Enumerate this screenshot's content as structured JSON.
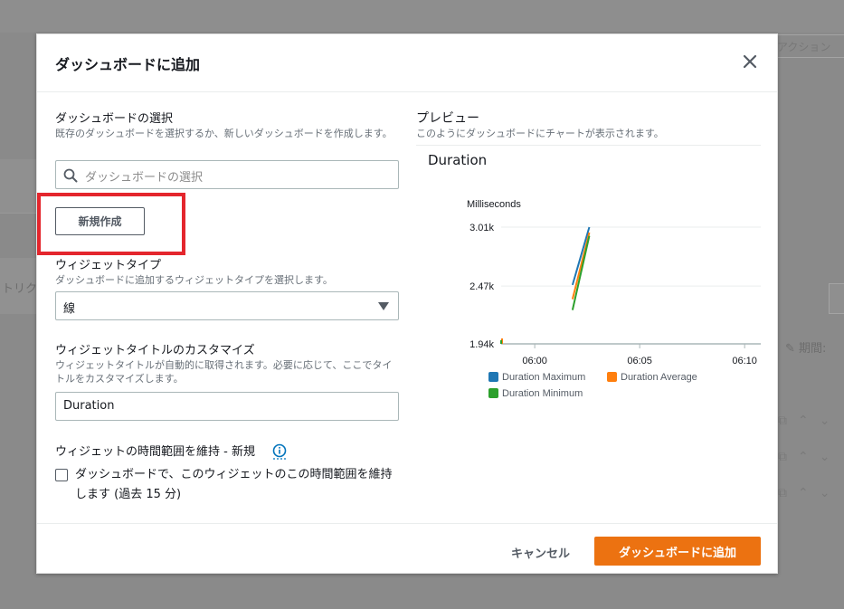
{
  "background": {
    "action_label": "アクション",
    "side_label": "トリク",
    "period_label": "期間:"
  },
  "modal": {
    "title": "ダッシュボードに追加",
    "dashboard_select": {
      "label": "ダッシュボードの選択",
      "description": "既存のダッシュボードを選択するか、新しいダッシュボードを作成します。",
      "placeholder": "ダッシュボードの選択"
    },
    "new_button": "新規作成",
    "widget_type": {
      "label": "ウィジェットタイプ",
      "description": "ダッシュボードに追加するウィジェットタイプを選択します。",
      "value": "線"
    },
    "widget_title": {
      "label": "ウィジェットタイトルのカスタマイズ",
      "description": "ウィジェットタイトルが自動的に取得されます。必要に応じて、ここでタイトルをカスタマイズします。",
      "value": "Duration"
    },
    "time_range": {
      "label": "ウィジェットの時間範囲を維持 - 新規",
      "checkbox_label": "ダッシュボードで、このウィジェットのこの時間範囲を維持します (過去 15 分)",
      "checked": false
    },
    "preview": {
      "title": "プレビュー",
      "description": "このようにダッシュボードにチャートが表示されます。"
    },
    "footer": {
      "cancel": "キャンセル",
      "submit": "ダッシュボードに追加"
    }
  },
  "colors": {
    "accent": "#ec7211",
    "highlight": "#e4262d",
    "series_max": "#1f77b4",
    "series_avg": "#ff7f0e",
    "series_min": "#2ca02c"
  },
  "chart_data": {
    "type": "line",
    "title": "Duration",
    "ylabel": "Milliseconds",
    "ytick_labels": [
      "3.01k",
      "2.47k",
      "1.94k"
    ],
    "yticks": [
      3010,
      2470,
      1940
    ],
    "xtick_labels": [
      "06:00",
      "06:05",
      "06:10"
    ],
    "xticks_min": [
      0,
      5,
      10
    ],
    "xlim_min": [
      -1.6,
      11.2
    ],
    "ylim": [
      1940,
      3010
    ],
    "series": [
      {
        "name": "Duration Maximum",
        "color": "#1f77b4",
        "x": [
          1.8,
          2.6
        ],
        "y": [
          2480,
          3010
        ]
      },
      {
        "name": "Duration Average",
        "color": "#ff7f0e",
        "x": [
          1.8,
          2.6
        ],
        "y": [
          2350,
          2960
        ]
      },
      {
        "name": "Duration Minimum",
        "color": "#2ca02c",
        "x": [
          1.8,
          2.6
        ],
        "y": [
          2250,
          2930
        ]
      }
    ],
    "grid": true,
    "legend": "bottom"
  }
}
